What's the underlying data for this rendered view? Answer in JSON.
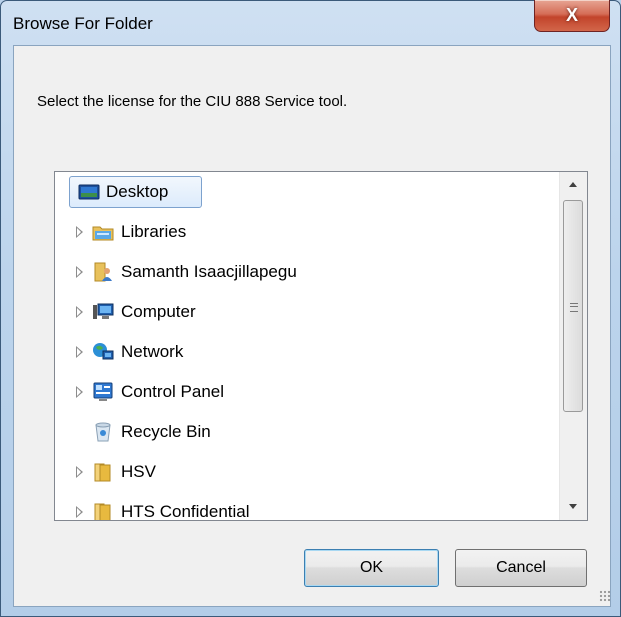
{
  "window": {
    "title": "Browse For Folder",
    "close_label": "X"
  },
  "prompt": "Select the license for the CIU 888 Service tool.",
  "tree": {
    "items": [
      {
        "label": "Desktop",
        "icon": "desktop-icon",
        "expandable": false,
        "selected": true
      },
      {
        "label": "Libraries",
        "icon": "libraries-icon",
        "expandable": true,
        "selected": false
      },
      {
        "label": "Samanth Isaacjillapegu",
        "icon": "user-folder-icon",
        "expandable": true,
        "selected": false
      },
      {
        "label": "Computer",
        "icon": "computer-icon",
        "expandable": true,
        "selected": false
      },
      {
        "label": "Network",
        "icon": "network-icon",
        "expandable": true,
        "selected": false
      },
      {
        "label": "Control Panel",
        "icon": "control-panel-icon",
        "expandable": true,
        "selected": false
      },
      {
        "label": "Recycle Bin",
        "icon": "recycle-bin-icon",
        "expandable": false,
        "selected": false
      },
      {
        "label": "HSV",
        "icon": "folder-icon",
        "expandable": true,
        "selected": false
      },
      {
        "label": "HTS Confidential",
        "icon": "folder-icon",
        "expandable": true,
        "selected": false
      }
    ]
  },
  "buttons": {
    "ok": "OK",
    "cancel": "Cancel"
  }
}
